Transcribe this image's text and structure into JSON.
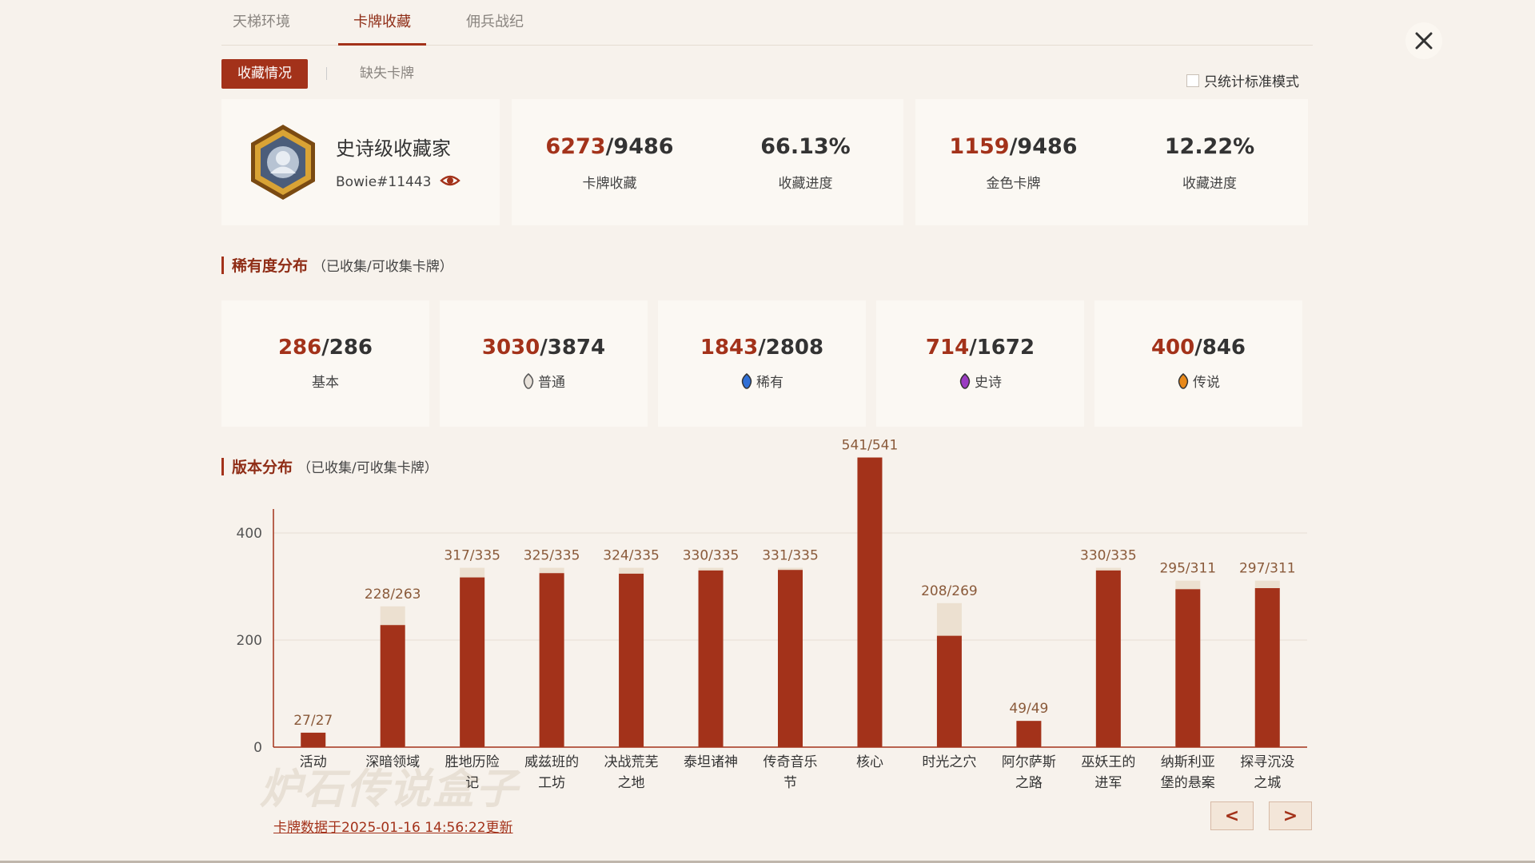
{
  "tabs": [
    {
      "label": "天梯环境",
      "active": false
    },
    {
      "label": "卡牌收藏",
      "active": true
    },
    {
      "label": "佣兵战纪",
      "active": false
    }
  ],
  "subtabs": [
    {
      "label": "收藏情况",
      "active": true
    },
    {
      "label": "缺失卡牌",
      "active": false
    }
  ],
  "standard_only": {
    "label": "只统计标准模式",
    "checked": false
  },
  "profile": {
    "title": "史诗级收藏家",
    "battletag": "Bowie#11443",
    "icon": "eye-icon"
  },
  "summary": {
    "collection": {
      "owned": "6273",
      "total": "/9486",
      "label": "卡牌收藏"
    },
    "collection_progress": {
      "value": "66.13%",
      "label": "收藏进度"
    },
    "golden": {
      "owned": "1159",
      "total": "/9486",
      "label": "金色卡牌"
    },
    "golden_progress": {
      "value": "12.22%",
      "label": "收藏进度"
    }
  },
  "rarity_section": {
    "title": "稀有度分布",
    "subtitle": "（已收集/可收集卡牌）"
  },
  "rarity": [
    {
      "owned": "286",
      "total": "/286",
      "label": "基本",
      "gem": "",
      "color": "#000000"
    },
    {
      "owned": "3030",
      "total": "/3874",
      "label": "普通",
      "gem": "common-gem-icon",
      "color": "#e8e2da"
    },
    {
      "owned": "1843",
      "total": "/2808",
      "label": "稀有",
      "gem": "rare-gem-icon",
      "color": "#2f6fd6"
    },
    {
      "owned": "714",
      "total": "/1672",
      "label": "史诗",
      "gem": "epic-gem-icon",
      "color": "#9a3cc2"
    },
    {
      "owned": "400",
      "total": "/846",
      "label": "传说",
      "gem": "legendary-gem-icon",
      "color": "#e8891a"
    }
  ],
  "version_section": {
    "title": "版本分布",
    "subtitle": "（已收集/可收集卡牌）"
  },
  "chart_data": {
    "type": "bar",
    "categories": [
      "活动",
      "深暗领域",
      "胜地历险记",
      "威兹班的工坊",
      "决战荒芜之地",
      "泰坦诸神",
      "传奇音乐节",
      "核心",
      "时光之穴",
      "阿尔萨斯之路",
      "巫妖王的进军",
      "纳斯利亚堡的悬案",
      "探寻沉没之城"
    ],
    "category_lines": [
      [
        "活动"
      ],
      [
        "深暗领域"
      ],
      [
        "胜地历险",
        "记"
      ],
      [
        "威兹班的",
        "工坊"
      ],
      [
        "决战荒芜",
        "之地"
      ],
      [
        "泰坦诸神"
      ],
      [
        "传奇音乐",
        "节"
      ],
      [
        "核心"
      ],
      [
        "时光之穴"
      ],
      [
        "阿尔萨斯",
        "之路"
      ],
      [
        "巫妖王的",
        "进军"
      ],
      [
        "纳斯利亚",
        "堡的悬案"
      ],
      [
        "探寻沉没",
        "之城"
      ]
    ],
    "series": [
      {
        "values": [
          27,
          228,
          317,
          325,
          324,
          330,
          331,
          541,
          208,
          49,
          330,
          295,
          297
        ]
      },
      {
        "values": [
          27,
          263,
          335,
          335,
          335,
          335,
          335,
          541,
          269,
          49,
          335,
          311,
          311
        ]
      }
    ],
    "data_labels": [
      "27/27",
      "228/263",
      "317/335",
      "325/335",
      "324/335",
      "330/335",
      "331/335",
      "541/541",
      "208/269",
      "49/49",
      "330/335",
      "295/311",
      "297/311"
    ],
    "yticks": [
      0,
      200,
      400
    ],
    "ylim": [
      0,
      440
    ],
    "grid": true,
    "colors": {
      "owned": "#a3321a",
      "total": "#ece0d0",
      "grid": "#e7dfd5",
      "axis": "#a3321a"
    }
  },
  "watermark": "炉石传说盒子",
  "footer": {
    "updated": "卡牌数据于2025-01-16 14:56:22更新",
    "prev": "<",
    "next": ">"
  },
  "close_icon": "close-icon"
}
